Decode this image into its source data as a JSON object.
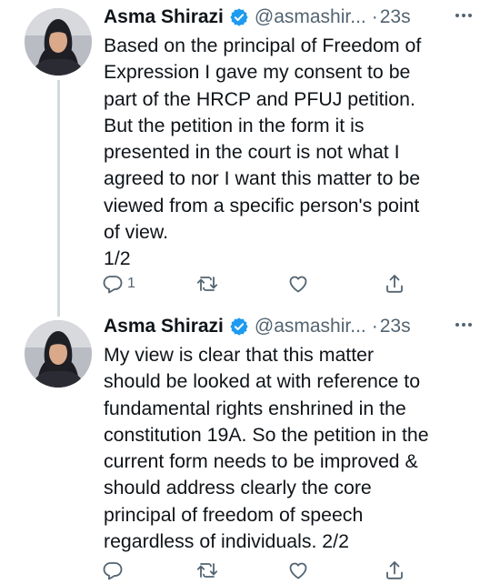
{
  "tweets": [
    {
      "author_name": "Asma Shirazi",
      "handle": "@asmashir...",
      "separator": "·",
      "time": "23s",
      "lines": [
        "Based on the principal of Freedom of",
        "Expression I gave my consent to be",
        "part of the HRCP and PFUJ petition.",
        "But the petition in the form it is",
        "presented in the court is not what I",
        "agreed to nor I want this matter to be",
        "viewed from a specific person's point",
        "of view.",
        "1/2"
      ],
      "reply_count": "1"
    },
    {
      "author_name": "Asma Shirazi",
      "handle": "@asmashir...",
      "separator": "·",
      "time": "23s",
      "lines": [
        "My view is clear that this matter",
        "should be looked at with reference to",
        "fundamental rights enshrined in the",
        "constitution 19A. So the petition in the",
        "current form needs to be improved &",
        "should address clearly the core",
        "principal of freedom of speech",
        "regardless of individuals. 2/2"
      ],
      "reply_count": ""
    }
  ],
  "icons": {
    "verified": "verified-badge-icon",
    "more": "more-options-icon",
    "reply": "reply-icon",
    "retweet": "retweet-icon",
    "like": "heart-icon",
    "share": "share-icon"
  },
  "colors": {
    "verified": "#1d9bf0",
    "secondary_text": "#536471",
    "primary_text": "#0f1419",
    "thread_line": "#cfd9de"
  }
}
